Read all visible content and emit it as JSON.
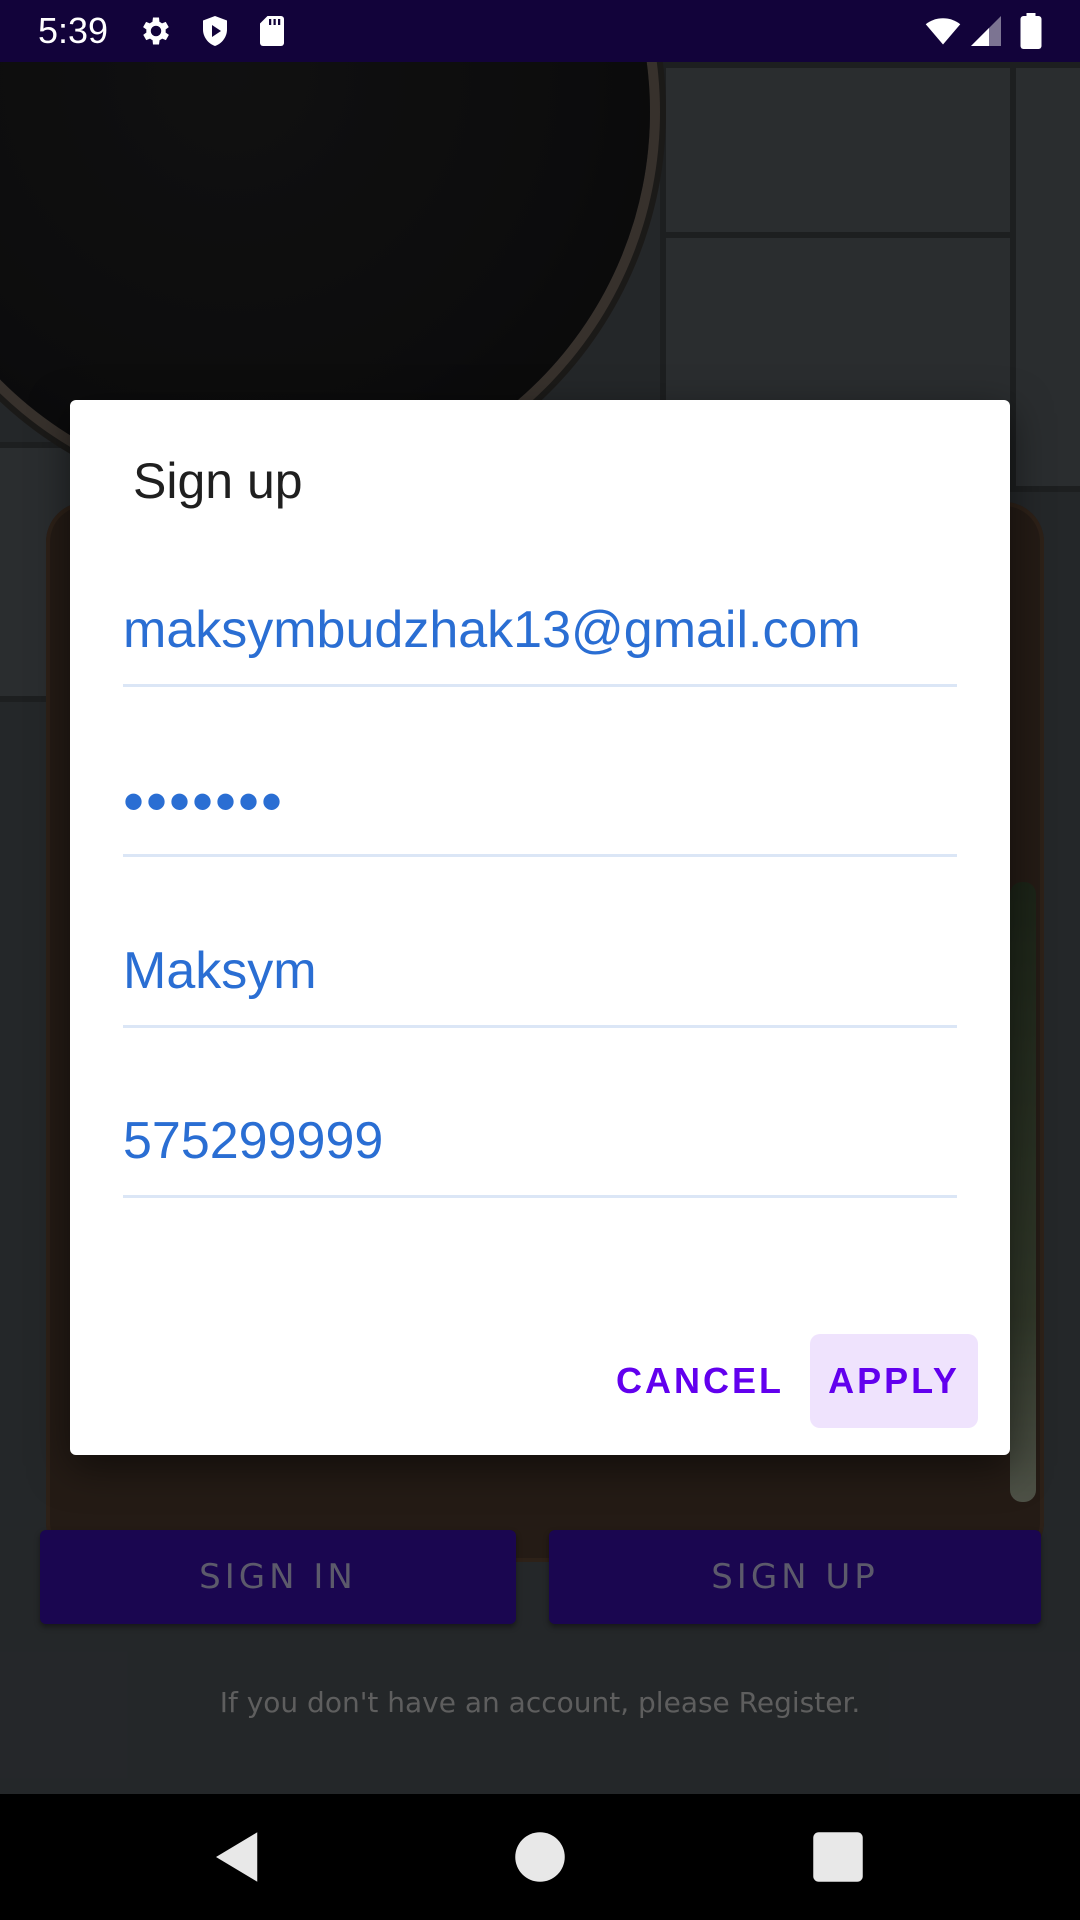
{
  "status_bar": {
    "time": "5:39",
    "icons": [
      "gear-icon",
      "shield-icon",
      "sd-card-icon",
      "wifi-icon",
      "cell-signal-icon",
      "battery-icon"
    ]
  },
  "dialog": {
    "title": "Sign up",
    "fields": {
      "email": "maksymbudzhak13@gmail.com",
      "password": "•••••••",
      "name": "Maksym",
      "phone": "575299999"
    },
    "cancel_label": "CANCEL",
    "apply_label": "APPLY"
  },
  "underlying_screen": {
    "sign_in_label": "SIGN IN",
    "sign_up_label": "SIGN UP",
    "register_hint": "If you don't have an account, please Register."
  },
  "nav_bar": {
    "icons": [
      "back-icon",
      "home-icon",
      "recents-icon"
    ]
  },
  "colors": {
    "status_bar": "#12033a",
    "accent": "#6200ee",
    "field_text": "#2a6ed3",
    "apply_bg": "#efe3fd",
    "primary_button": "#1a0650"
  }
}
